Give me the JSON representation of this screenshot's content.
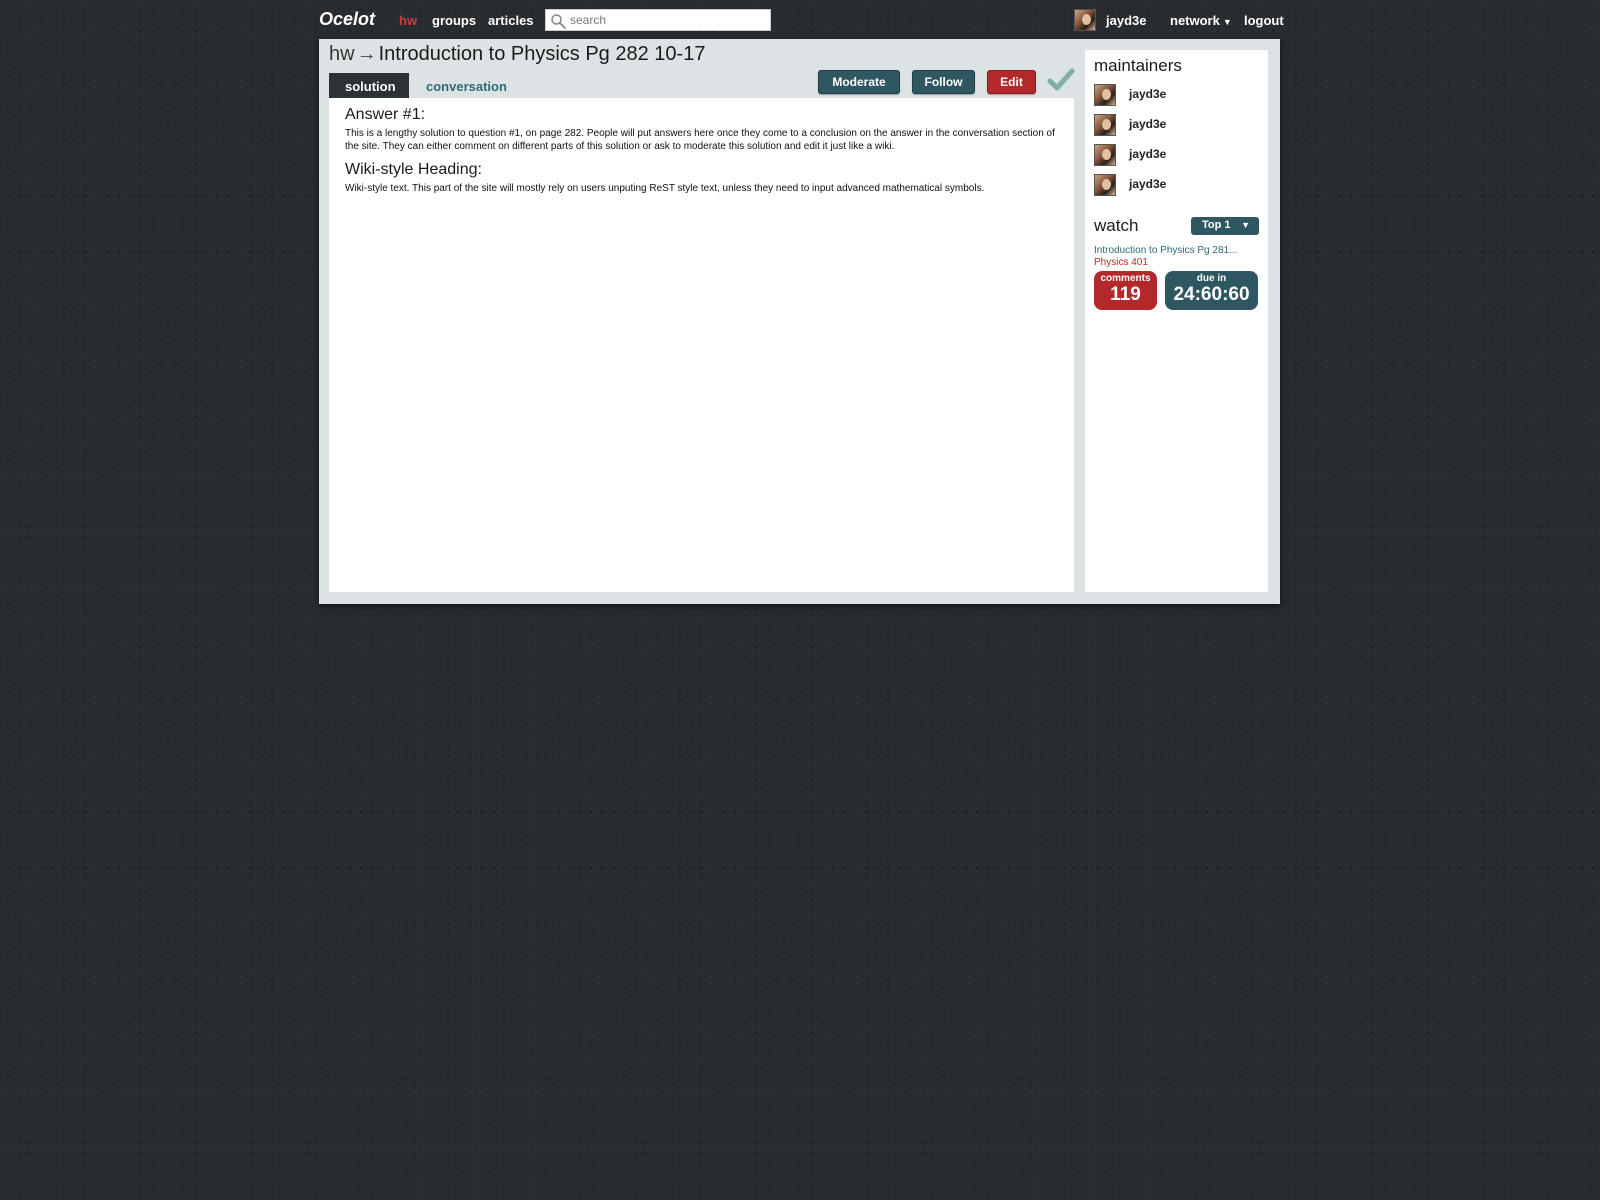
{
  "nav": {
    "logo": "Ocelot",
    "links": [
      {
        "label": "hw",
        "active": true
      },
      {
        "label": "groups",
        "active": false
      },
      {
        "label": "articles",
        "active": false
      }
    ],
    "search_placeholder": "search",
    "search_value": "",
    "user_name": "jayd3e",
    "network_label": "network",
    "logout_label": "logout"
  },
  "page": {
    "breadcrumb": "hw",
    "arrow": "→",
    "title": "Introduction to Physics Pg 282 10-17",
    "tabs": [
      {
        "label": "solution",
        "active": true
      },
      {
        "label": "conversation",
        "active": false
      }
    ],
    "buttons": {
      "moderate": "Moderate",
      "follow": "Follow",
      "edit": "Edit"
    }
  },
  "content": {
    "sections": [
      {
        "heading": "Answer #1:",
        "text": "This is a lengthy solution to question #1, on page 282.  People will put answers here once they come to a conclusion on the answer in the conversation section of the site.  They can either comment on different parts of this solution or ask to moderate this solution and edit it just like a wiki."
      },
      {
        "heading": "Wiki-style Heading:",
        "text": "Wiki-style text.  This part of the site will mostly rely on users unputing ReST style text, unless they need to input advanced mathematical symbols."
      }
    ]
  },
  "sidebar": {
    "maintainers_title": "maintainers",
    "maintainers": [
      "jayd3e",
      "jayd3e",
      "jayd3e",
      "jayd3e"
    ],
    "watch_title": "watch",
    "watch_select": "Top 1",
    "watch_item": {
      "title": "Introduction to Physics Pg 281...",
      "course": "Physics 401",
      "comments_label": "comments",
      "comments_count": "119",
      "due_label": "due in",
      "due_value": "24:60:60"
    }
  },
  "colors": {
    "background": "#282c2e",
    "accent_teal": "#2f5761",
    "accent_red": "#b2282b",
    "active_nav": "#d03a3a",
    "link_teal": "#2f6a73"
  },
  "icons": [
    "search-icon",
    "checkmark-icon",
    "chevron-down-icon"
  ]
}
